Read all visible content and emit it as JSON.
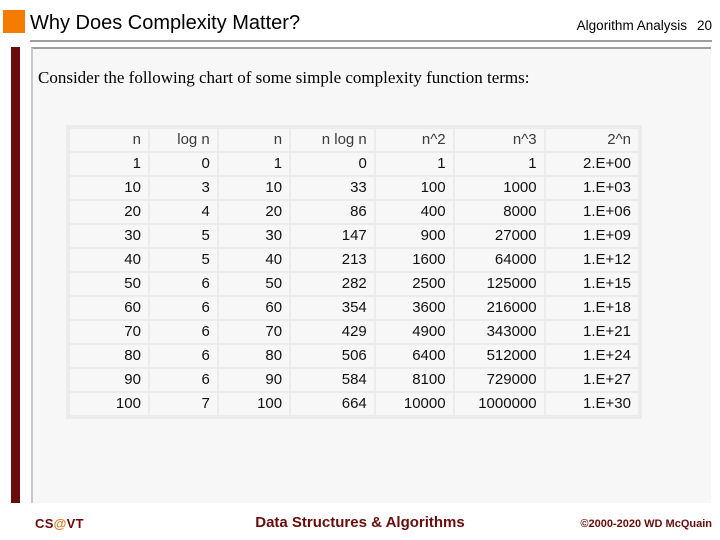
{
  "header": {
    "title": "Why Does Complexity Matter?",
    "topic": "Algorithm Analysis",
    "slide_number": "20"
  },
  "body": {
    "intro_text": "Consider the following chart of some simple complexity function terms:"
  },
  "table": {
    "columns": [
      "n",
      "log n",
      "n",
      "n log n",
      "n^2",
      "n^3",
      "2^n"
    ],
    "rows": [
      [
        "1",
        "0",
        "1",
        "0",
        "1",
        "1",
        "2.E+00"
      ],
      [
        "10",
        "3",
        "10",
        "33",
        "100",
        "1000",
        "1.E+03"
      ],
      [
        "20",
        "4",
        "20",
        "86",
        "400",
        "8000",
        "1.E+06"
      ],
      [
        "30",
        "5",
        "30",
        "147",
        "900",
        "27000",
        "1.E+09"
      ],
      [
        "40",
        "5",
        "40",
        "213",
        "1600",
        "64000",
        "1.E+12"
      ],
      [
        "50",
        "6",
        "50",
        "282",
        "2500",
        "125000",
        "1.E+15"
      ],
      [
        "60",
        "6",
        "60",
        "354",
        "3600",
        "216000",
        "1.E+18"
      ],
      [
        "70",
        "6",
        "70",
        "429",
        "4900",
        "343000",
        "1.E+21"
      ],
      [
        "80",
        "6",
        "80",
        "506",
        "6400",
        "512000",
        "1.E+24"
      ],
      [
        "90",
        "6",
        "90",
        "584",
        "8100",
        "729000",
        "1.E+27"
      ],
      [
        "100",
        "7",
        "100",
        "664",
        "10000",
        "1000000",
        "1.E+30"
      ]
    ]
  },
  "footer": {
    "logo_prefix": "CS",
    "logo_at": "@",
    "logo_suffix": "VT",
    "course": "Data Structures & Algorithms",
    "copyright": "©2000-2020 WD McQuain"
  },
  "colors": {
    "accent_orange": "#F57C00",
    "accent_maroon": "#6B0C0C",
    "panel_bg": "#F7F7F7",
    "rule_gray": "#9E9E9E"
  }
}
